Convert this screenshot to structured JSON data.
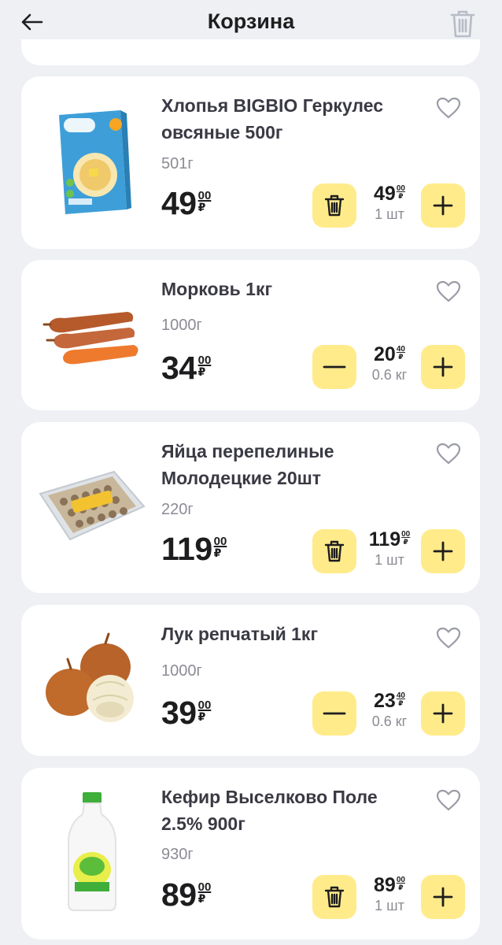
{
  "header": {
    "title": "Корзина",
    "back_icon": "arrow-left-icon",
    "trash_icon": "trash-icon"
  },
  "colors": {
    "accent": "#ffeb8a",
    "background": "#eef0f4",
    "card": "#ffffff"
  },
  "currency": "₽",
  "items": [
    {
      "name": "Хлопья BIGBIO Геркулес овсяные 500г",
      "weight": "501г",
      "price_int": "49",
      "price_frac": "00",
      "unit_price_int": "49",
      "unit_price_frac": "00",
      "amount": "1 шт",
      "left_action": "trash",
      "image": "oat-flakes-box"
    },
    {
      "name": "Морковь 1кг",
      "weight": "1000г",
      "price_int": "34",
      "price_frac": "00",
      "unit_price_int": "20",
      "unit_price_frac": "40",
      "amount": "0.6 кг",
      "left_action": "minus",
      "image": "carrots"
    },
    {
      "name": "Яйца перепелиные Молодецкие 20шт",
      "weight": "220г",
      "price_int": "119",
      "price_frac": "00",
      "unit_price_int": "119",
      "unit_price_frac": "00",
      "amount": "1 шт",
      "left_action": "trash",
      "image": "quail-eggs-pack"
    },
    {
      "name": "Лук репчатый 1кг",
      "weight": "1000г",
      "price_int": "39",
      "price_frac": "00",
      "unit_price_int": "23",
      "unit_price_frac": "40",
      "amount": "0.6 кг",
      "left_action": "minus",
      "image": "onions"
    },
    {
      "name": "Кефир Выселково Поле 2.5% 900г",
      "weight": "930г",
      "price_int": "89",
      "price_frac": "00",
      "unit_price_int": "89",
      "unit_price_frac": "00",
      "amount": "1 шт",
      "left_action": "trash",
      "image": "kefir-bottle"
    }
  ]
}
